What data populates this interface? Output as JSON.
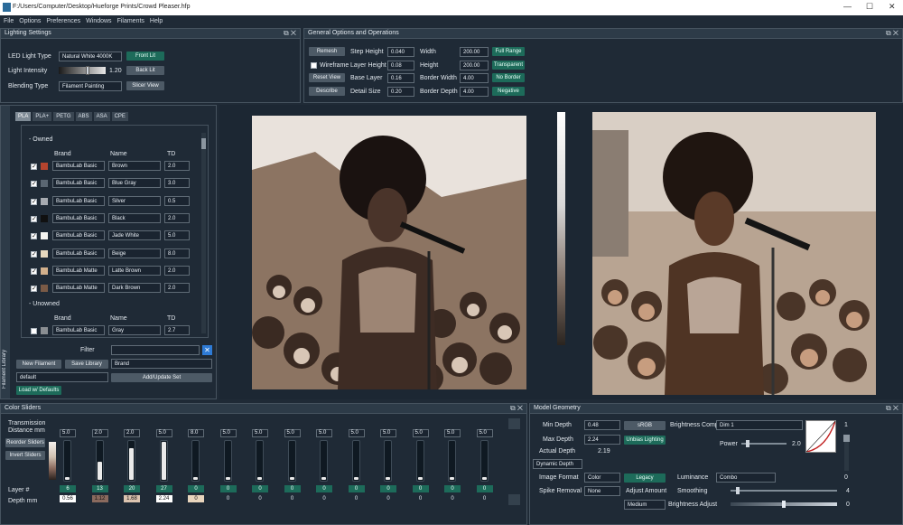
{
  "window": {
    "title": "F:/Users/Computer/Desktop/Hueforge Prints/Crowd Pleaser.hfp"
  },
  "menu": [
    "File",
    "Options",
    "Preferences",
    "Windows",
    "Filaments",
    "Help"
  ],
  "lighting": {
    "title": "Lighting Settings",
    "led_label": "LED Light Type",
    "led_value": "Natural White 4000K",
    "front_lit": "Front Lit",
    "intensity_label": "Light Intensity",
    "intensity_value": "1.20",
    "intensity_level": 0.62,
    "back_lit": "Back Lit",
    "blend_label": "Blending Type",
    "blend_value": "Filament Painting",
    "slicer_view": "Slicer View"
  },
  "general": {
    "title": "General Options and Operations",
    "remesh": "Remesh",
    "wireframe": "Wireframe",
    "reset_view": "Reset View",
    "describe": "Describe",
    "step_height_label": "Step Height",
    "step_height": "0.040",
    "layer_height_label": "Layer Height",
    "layer_height": "0.08",
    "base_layer_label": "Base Layer",
    "base_layer": "0.16",
    "detail_size_label": "Detail Size",
    "detail_size": "0.20",
    "width_label": "Width",
    "width": "200.00",
    "height_label": "Height",
    "height": "200.00",
    "border_width_label": "Border Width",
    "border_width": "4.00",
    "border_depth_label": "Border Depth",
    "border_depth": "4.00",
    "full_range": "Full Range",
    "transparent": "Transparent",
    "no_border": "No Border",
    "negative": "Negative"
  },
  "library": {
    "side_label": "Filament Library",
    "tabs": [
      "PLA",
      "PLA+",
      "PETG",
      "ABS",
      "ASA",
      "CPE"
    ],
    "owned_label": "- Owned",
    "unowned_label": "- Unowned",
    "col_brand": "Brand",
    "col_name": "Name",
    "col_td": "TD",
    "owned": [
      {
        "brand": "BambuLab Basic",
        "name": "Brown",
        "td": "2.0",
        "color": "#b5442e"
      },
      {
        "brand": "BambuLab Basic",
        "name": "Blue Gray",
        "td": "3.0",
        "color": "#5a6672"
      },
      {
        "brand": "BambuLab Basic",
        "name": "Silver",
        "td": "0.5",
        "color": "#a6aab0"
      },
      {
        "brand": "BambuLab Basic",
        "name": "Black",
        "td": "2.0",
        "color": "#101010"
      },
      {
        "brand": "BambuLab Basic",
        "name": "Jade White",
        "td": "5.0",
        "color": "#f4f4f0"
      },
      {
        "brand": "BambuLab Basic",
        "name": "Beige",
        "td": "8.0",
        "color": "#e6d8bf"
      },
      {
        "brand": "BambuLab Matte",
        "name": "Latte Brown",
        "td": "2.0",
        "color": "#d2b08c"
      },
      {
        "brand": "BambuLab Matte",
        "name": "Dark Brown",
        "td": "2.0",
        "color": "#7a5a46"
      }
    ],
    "unowned": [
      {
        "brand": "BambuLab Basic",
        "name": "Gray",
        "td": "2.7",
        "color": "#8a8e92"
      }
    ],
    "filter_label": "Filter",
    "new_filament": "New Filament",
    "save_library": "Save Library",
    "sort_value": "Brand",
    "set_value": "default",
    "add_update_set": "Add/Update Set",
    "load_defaults": "Load w/ Defaults"
  },
  "color_sliders": {
    "title": "Color Sliders",
    "transmission_label": "Transmission Distance mm",
    "reorder": "Reorder Sliders",
    "invert": "Invert Sliders",
    "layer_label": "Layer #",
    "depth_label": "Depth mm",
    "sliders": [
      {
        "td": "5.0",
        "level": 0.0,
        "layer": "6",
        "depth": "0.56",
        "hl": "#ffffff",
        "tcolor": "#111111"
      },
      {
        "td": "2.0",
        "level": 0.45,
        "layer": "13",
        "depth": "1.12",
        "hl": "#8a6a5e",
        "tcolor": "#111111"
      },
      {
        "td": "2.0",
        "level": 0.8,
        "layer": "20",
        "depth": "1.68",
        "hl": "#dcc4b0",
        "tcolor": "#111111"
      },
      {
        "td": "5.0",
        "level": 0.95,
        "layer": "27",
        "depth": "2.24",
        "hl": "#ffffff",
        "tcolor": "#111111"
      },
      {
        "td": "8.0",
        "level": 0.05,
        "layer": "0",
        "depth": "0",
        "hl": "#e8d5bd",
        "tcolor": "#111111"
      },
      {
        "td": "5.0",
        "level": 0.05,
        "layer": "0",
        "depth": "0",
        "hl": "",
        "tcolor": "#dfe6ee"
      },
      {
        "td": "5.0",
        "level": 0.05,
        "layer": "0",
        "depth": "0",
        "hl": "",
        "tcolor": "#dfe6ee"
      },
      {
        "td": "5.0",
        "level": 0.05,
        "layer": "0",
        "depth": "0",
        "hl": "",
        "tcolor": "#dfe6ee"
      },
      {
        "td": "5.0",
        "level": 0.05,
        "layer": "0",
        "depth": "0",
        "hl": "",
        "tcolor": "#dfe6ee"
      },
      {
        "td": "5.0",
        "level": 0.05,
        "layer": "0",
        "depth": "0",
        "hl": "",
        "tcolor": "#dfe6ee"
      },
      {
        "td": "5.0",
        "level": 0.05,
        "layer": "0",
        "depth": "0",
        "hl": "",
        "tcolor": "#dfe6ee"
      },
      {
        "td": "5.0",
        "level": 0.05,
        "layer": "0",
        "depth": "0",
        "hl": "",
        "tcolor": "#dfe6ee"
      },
      {
        "td": "5.0",
        "level": 0.05,
        "layer": "0",
        "depth": "0",
        "hl": "",
        "tcolor": "#dfe6ee"
      },
      {
        "td": "5.0",
        "level": 0.05,
        "layer": "0",
        "depth": "0",
        "hl": "",
        "tcolor": "#dfe6ee"
      }
    ]
  },
  "geometry": {
    "title": "Model Geometry",
    "min_depth_label": "Min Depth",
    "min_depth": "0.48",
    "max_depth_label": "Max Depth",
    "max_depth": "2.24",
    "actual_depth_label": "Actual Depth",
    "actual_depth": "2.19",
    "srgb": "sRGB",
    "unbias": "Unbias Lighting",
    "dynamic_depth": "Dynamic Depth",
    "brightness_comp_label": "Brightness Comp",
    "brightness_comp": "Dim 1",
    "power_label": "Power",
    "power": "2.0",
    "power_level": 0.1,
    "image_format_label": "Image Format",
    "image_format": "Color",
    "legacy": "Legacy",
    "luminance_label": "Luminance",
    "luminance": "Combo",
    "spike_label": "Spike Removal",
    "spike": "None",
    "adjust_amount_label": "Adjust Amount",
    "smoothing_label": "Smoothing",
    "smoothing": "4",
    "smoothing_level": 0.05,
    "medium": "Medium",
    "brightness_adjust_label": "Brightness Adjust",
    "brightness_adjust": "0",
    "brightness_level": 0.5,
    "curve_top": "1",
    "curve_bottom": "0"
  },
  "colors": {
    "accent_green": "#1d6b5a",
    "panel_bg": "#1f2a36",
    "header_bg": "#2d3b48"
  }
}
